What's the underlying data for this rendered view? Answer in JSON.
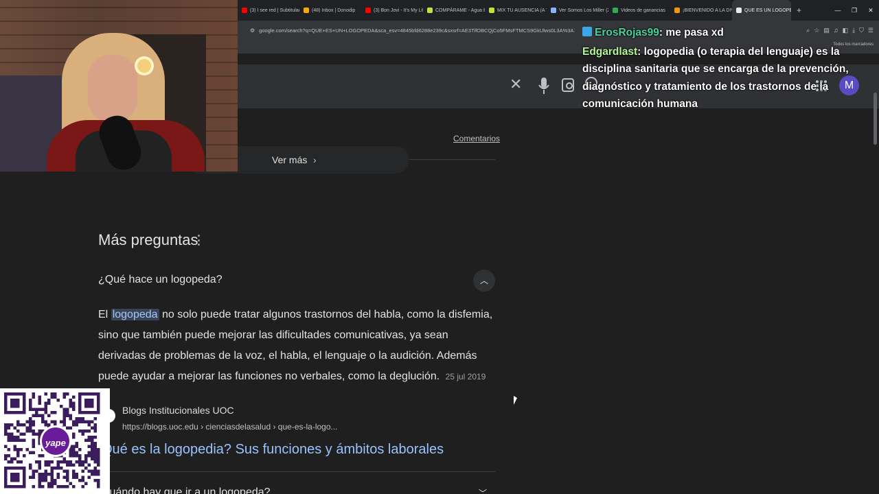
{
  "browser": {
    "tabs": [
      {
        "label": "(3) I see red | Subtitulado",
        "icon": "youtube-icon",
        "color": "#ff0000"
      },
      {
        "label": "(48) Inbox | Donodip",
        "icon": "mail-icon",
        "color": "#f9ab00"
      },
      {
        "label": "(3) Bon Jovi - It's My Life",
        "icon": "youtube-icon",
        "color": "#ff0000"
      },
      {
        "label": "COMPÁRAME - Agua Bendita",
        "icon": "music-icon",
        "color": "#c6e03b"
      },
      {
        "label": "MIX TU AUSENCIA (A TI)",
        "icon": "music-icon",
        "color": "#c6e03b"
      },
      {
        "label": "Ver Somos Los Miller (2...",
        "icon": "play-icon",
        "color": "#8ab4f8"
      },
      {
        "label": "Videos de ganancias",
        "icon": "chart-icon",
        "color": "#34a853"
      },
      {
        "label": "¡BIENVENIDO A LA DIVE...",
        "icon": "info-icon",
        "color": "#f29900"
      },
      {
        "label": "QUE ES UN LOGOPEDA",
        "icon": "google-icon",
        "color": "#e8eaed",
        "active": true
      }
    ],
    "new_tab": "+",
    "url": "google.com/search?q=QUE+ES+UN+LOGOPEDA&sca_esv=4845bfd6288e239c&sxsrf=AE3TifOBCQjCo5FMsFTMCS9GkUlws0L3A%3A1767328..",
    "bookmarks_label": "Todos los marcadores",
    "avatar_letter": "M"
  },
  "results": {
    "comentarios": "Comentarios",
    "ver_mas": "Ver más",
    "mas_preguntas": "Más preguntas",
    "q1": "¿Qué hace un logopeda?",
    "answer_prefix": "El",
    "answer_highlight": "logopeda",
    "answer_text": "no solo puede tratar algunos trastornos del habla, como la disfemia, sino que también puede mejorar las dificultades comunicativas, ya sean derivadas de problemas de la voz, el habla, el lenguaje o la audición. Además puede ayudar a mejorar las funciones no verbales, como la deglución.",
    "answer_date": "25 jul 2019",
    "source_name": "Blogs Institucionales UOC",
    "source_url": "https://blogs.uoc.edu › cienciasdelasalud › que-es-la-logo...",
    "source_title": "Qué es la logopedia? Sus funciones y ámbitos laborales",
    "q2": "Cuándo hay que ir a un logopeda?"
  },
  "chat": [
    {
      "user": "ErosRojas99",
      "text": ": me pasa xd",
      "color": "#4ad29f"
    },
    {
      "user": "Edgardlast",
      "text": ": logopedia (o terapia del lenguaje) es la disciplina sanitaria que se encarga de la prevención, diagnóstico y tratamiento de los trastornos de la comunicación humana",
      "color": "#b6f59a"
    }
  ],
  "overlay": {
    "qr_brand": "yape"
  }
}
